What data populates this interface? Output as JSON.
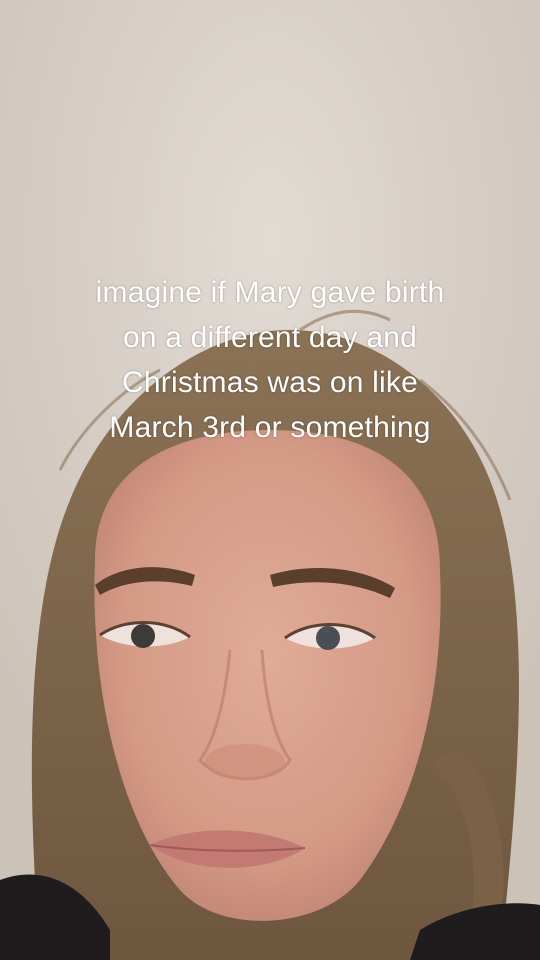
{
  "caption": {
    "lines": [
      "imagine if Mary gave birth",
      "on a different day and",
      "Christmas was on like",
      "March 3rd or something"
    ]
  },
  "colors": {
    "wall": "#d8d0c8",
    "hair": "#8a6e52",
    "skin": "#d69e8c",
    "shirt": "#1e1c1c",
    "caption_text": "#ffffff"
  }
}
